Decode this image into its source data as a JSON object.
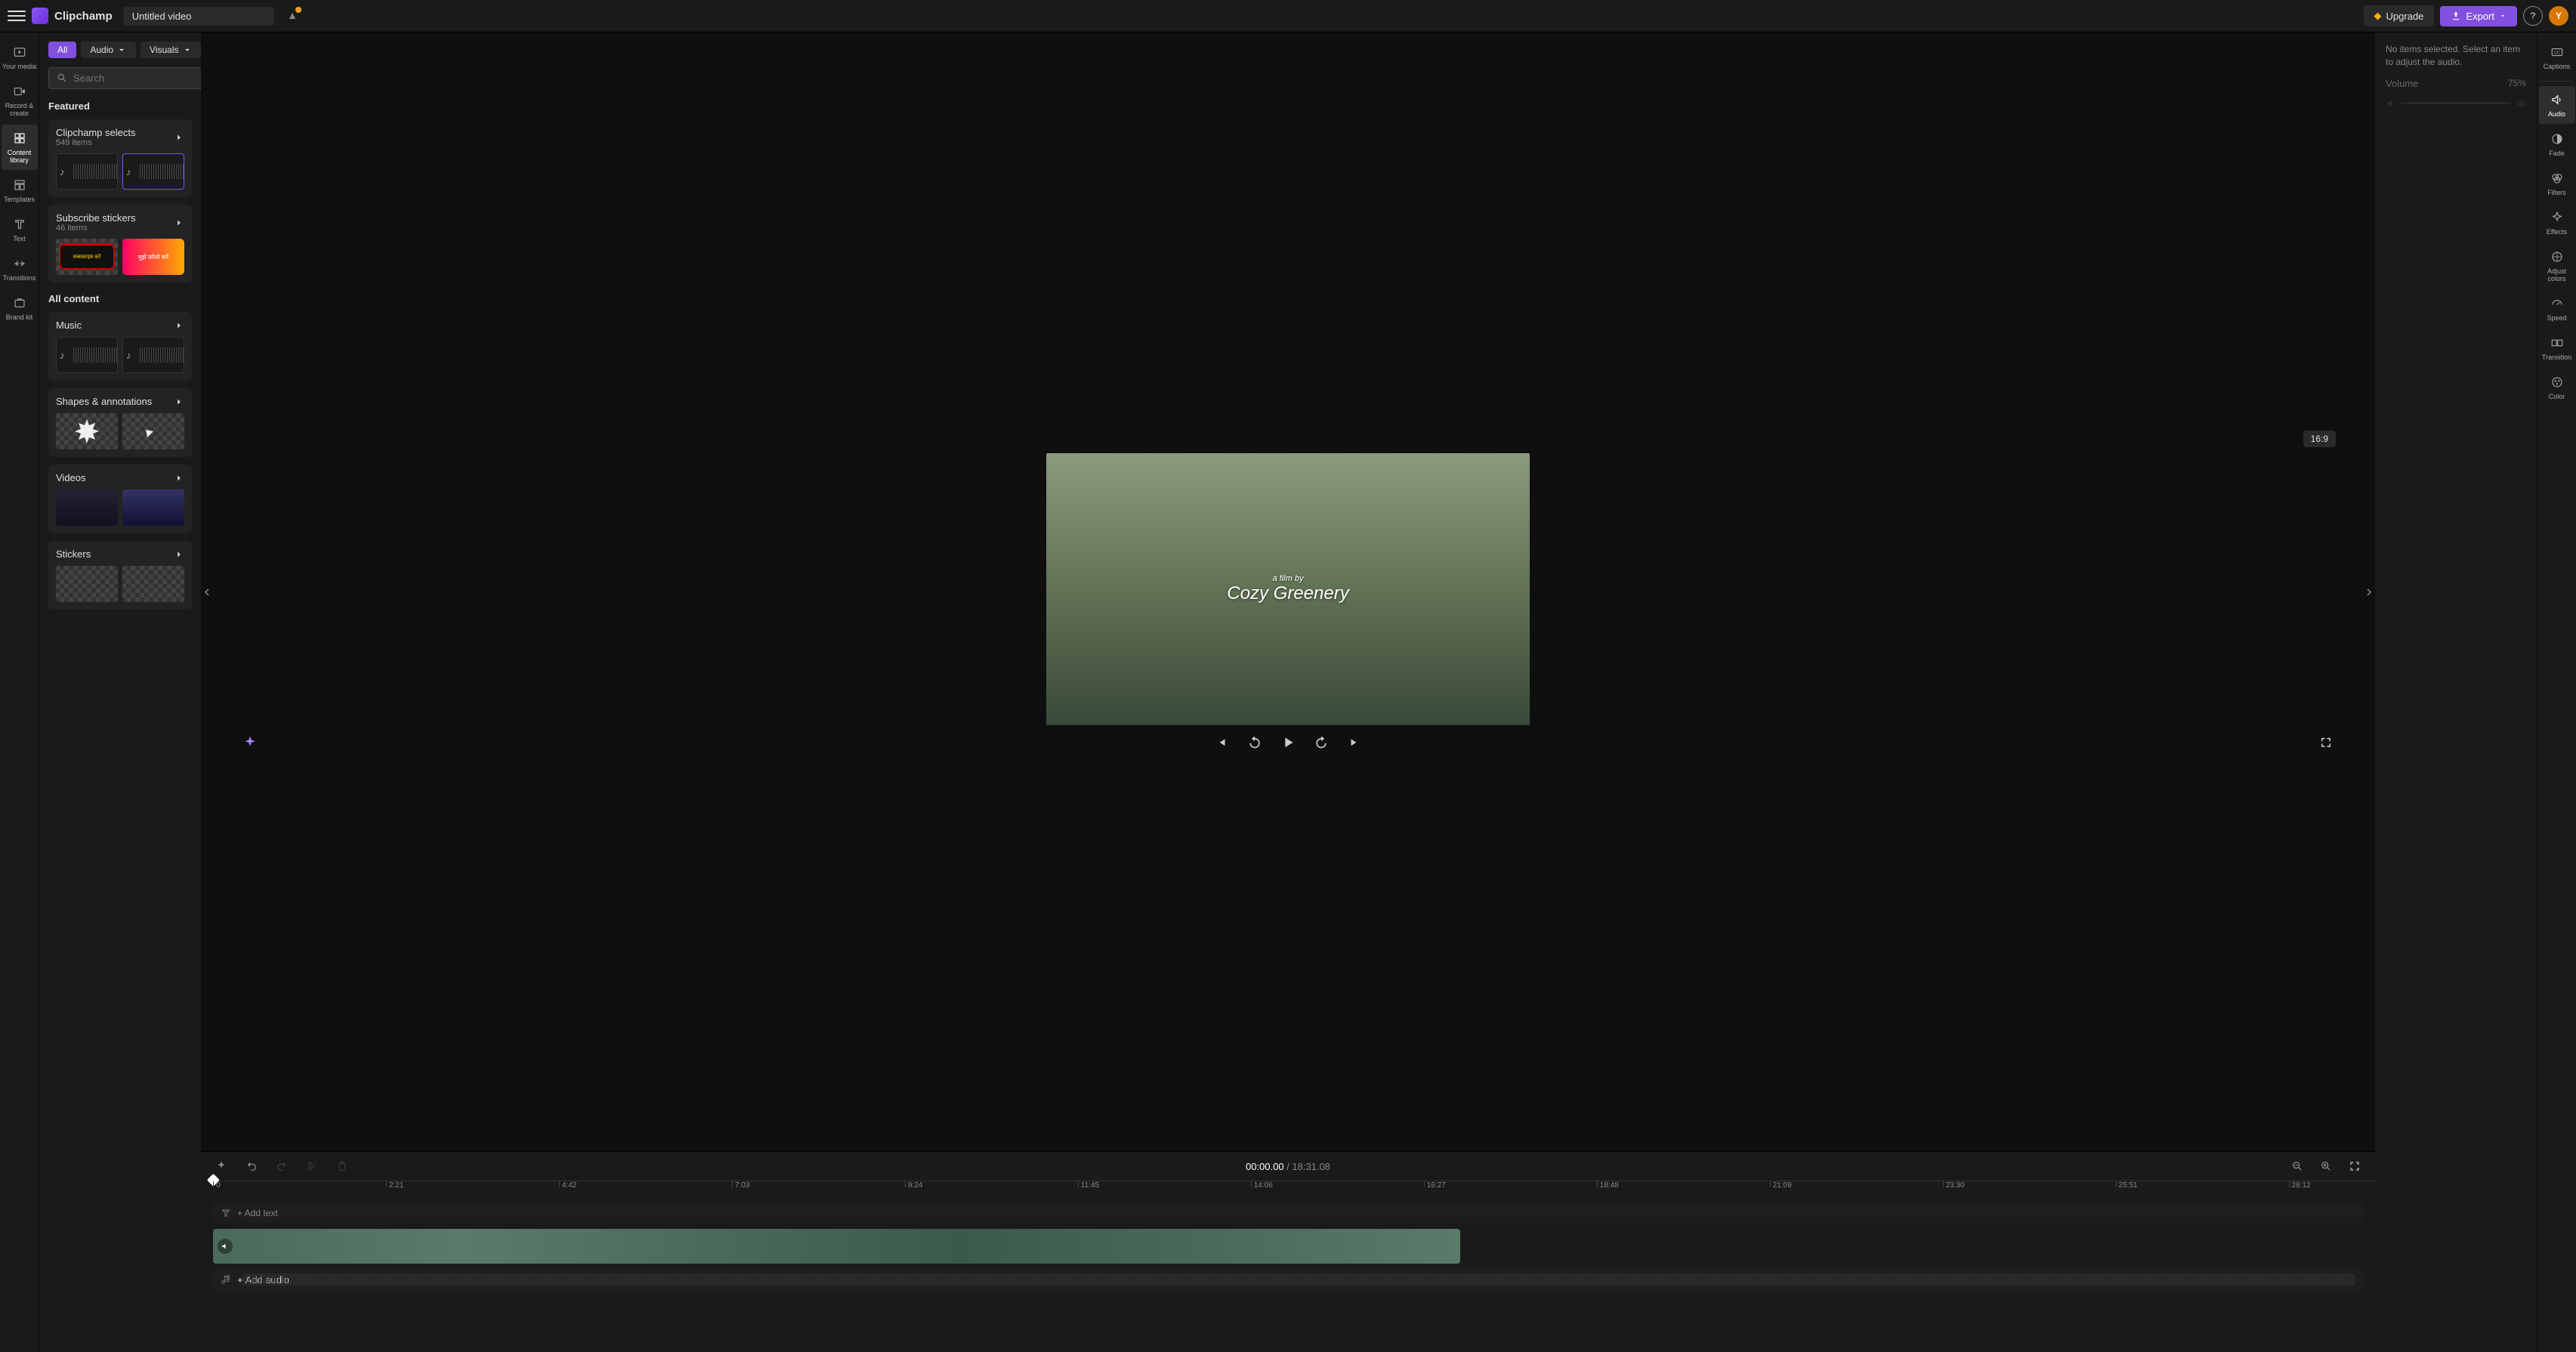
{
  "header": {
    "brand": "Clipchamp",
    "title": "Untitled video",
    "upgrade": "Upgrade",
    "export": "Export",
    "avatar_letter": "Y"
  },
  "leftrail": [
    {
      "label": "Your media"
    },
    {
      "label": "Record & create"
    },
    {
      "label": "Content library"
    },
    {
      "label": "Templates"
    },
    {
      "label": "Text"
    },
    {
      "label": "Transitions"
    },
    {
      "label": "Brand kit"
    }
  ],
  "sidebar": {
    "pills": {
      "all": "All",
      "audio": "Audio",
      "visuals": "Visuals"
    },
    "search_placeholder": "Search",
    "featured_title": "Featured",
    "clipchamp_selects": {
      "title": "Clipchamp selects",
      "sub": "549 items"
    },
    "subscribe_stickers": {
      "title": "Subscribe stickers",
      "sub": "46 items",
      "thumb1": "सब्सक्राइब करें",
      "thumb2": "मुझे फ़ॉलो करें"
    },
    "all_content_title": "All content",
    "music": {
      "title": "Music"
    },
    "shapes": {
      "title": "Shapes & annotations"
    },
    "videos": {
      "title": "Videos"
    },
    "stickers": {
      "title": "Stickers"
    }
  },
  "preview": {
    "aspect": "16:9",
    "overlay_small": "a film by",
    "overlay_script": "Cozy Greenery"
  },
  "rightpanel": {
    "message": "No items selected. Select an item to adjust the audio.",
    "volume_label": "Volume",
    "volume_value": "75%"
  },
  "rightrail": [
    {
      "label": "Captions"
    },
    {
      "label": "Audio"
    },
    {
      "label": "Fade"
    },
    {
      "label": "Filters"
    },
    {
      "label": "Effects"
    },
    {
      "label": "Adjust colors"
    },
    {
      "label": "Speed"
    },
    {
      "label": "Transition"
    },
    {
      "label": "Color"
    }
  ],
  "timeline": {
    "current": "00:00.00",
    "duration": "18:31.08",
    "ticks": [
      "0",
      "2:21",
      "4:42",
      "7:03",
      "9:24",
      "11:45",
      "14:06",
      "16:27",
      "18:48",
      "21:09",
      "23:30",
      "25:51",
      "28:12"
    ],
    "add_text": "+ Add text",
    "add_audio": "+ Add audio"
  }
}
